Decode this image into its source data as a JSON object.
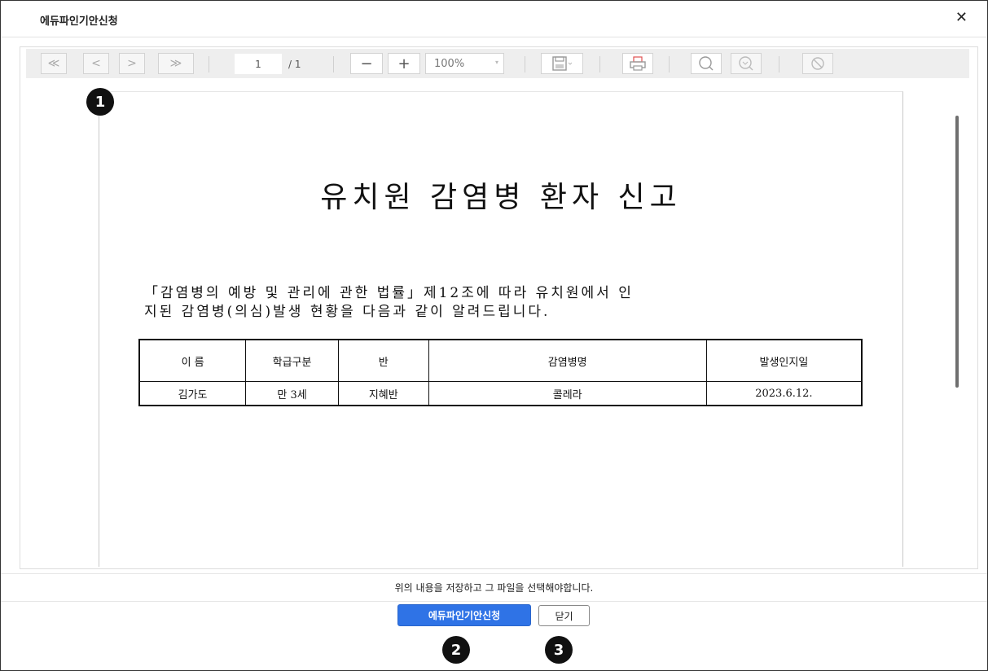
{
  "dialog": {
    "title": "에듀파인기안신청",
    "close_icon": "✕"
  },
  "toolbar": {
    "first_page": "≪",
    "prev_page": "<",
    "next_page": ">",
    "last_page": "≫",
    "current_page": "1",
    "total_pages": "/ 1",
    "zoom_out": "−",
    "zoom_in": "+",
    "zoom_value": "100%"
  },
  "document": {
    "title": "유치원 감염병 환자 신고",
    "paragraph_line1": "「감염병의 예방 및 관리에 관한 법률」제12조에 따라 유치원에서 인",
    "paragraph_line2": "지된 감염병(의심)발생 현황을 다음과 같이 알려드립니다.",
    "table": {
      "headers": [
        "이 름",
        "학급구분",
        "반",
        "감염병명",
        "발생인지일"
      ],
      "rows": [
        [
          "김가도",
          "만 3세",
          "지혜반",
          "콜레라",
          "2023.6.12."
        ]
      ]
    }
  },
  "markers": [
    "1",
    "2",
    "3"
  ],
  "footer": {
    "notice": "위의 내용을 저장하고 그 파일을 선택해야합니다.",
    "submit_label": "에듀파인기안신청",
    "close_label": "닫기"
  }
}
